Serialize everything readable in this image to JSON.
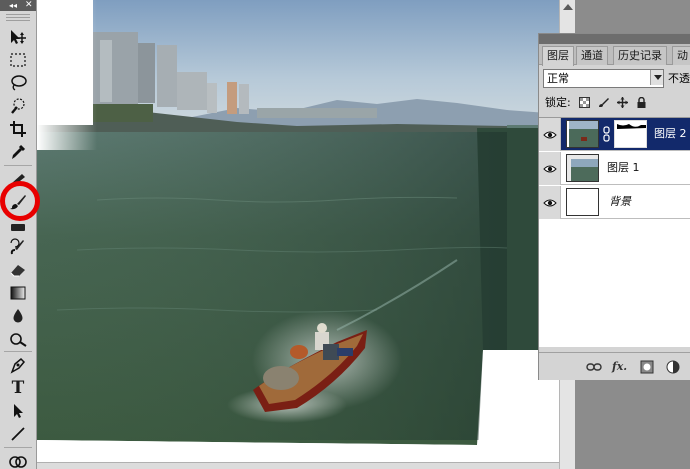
{
  "toolbox": {
    "collapse_glyph": "◂◂",
    "close_glyph": "✕",
    "tools": [
      {
        "name": "move-tool",
        "icon": "move-icon"
      },
      {
        "name": "marquee-tool",
        "icon": "marquee-icon"
      },
      {
        "name": "lasso-tool",
        "icon": "lasso-icon"
      },
      {
        "name": "quick-selection-tool",
        "icon": "quick-selection-icon"
      },
      {
        "name": "crop-tool",
        "icon": "crop-icon"
      },
      {
        "name": "eyedropper-tool",
        "icon": "eyedropper-icon"
      },
      {
        "name": "healing-brush-tool",
        "icon": "healing-brush-icon"
      },
      {
        "name": "brush-tool",
        "icon": "brush-icon"
      },
      {
        "name": "clone-stamp-tool",
        "icon": "clone-stamp-icon"
      },
      {
        "name": "history-brush-tool",
        "icon": "history-brush-icon"
      },
      {
        "name": "eraser-tool",
        "icon": "eraser-icon"
      },
      {
        "name": "gradient-tool",
        "icon": "gradient-icon"
      },
      {
        "name": "blur-tool",
        "icon": "blur-drop-icon"
      },
      {
        "name": "dodge-tool",
        "icon": "dodge-icon"
      },
      {
        "name": "pen-tool",
        "icon": "pen-icon"
      },
      {
        "name": "type-tool",
        "icon": "type-icon"
      },
      {
        "name": "path-selection-tool",
        "icon": "path-selection-icon"
      },
      {
        "name": "line-tool",
        "icon": "line-icon"
      },
      {
        "name": "3d-tool",
        "icon": "3d-rotate-icon"
      }
    ],
    "type_glyph": "T",
    "highlight_color": "#e80000"
  },
  "layers_panel": {
    "tabs": [
      {
        "label": "图层",
        "active": true
      },
      {
        "label": "通道",
        "active": false
      },
      {
        "label": "历史记录",
        "active": false
      },
      {
        "label": "动",
        "active": false
      }
    ],
    "blend_mode": "正常",
    "opacity_label": "不透",
    "lock_label": "锁定:",
    "layers": [
      {
        "name": "图层 2",
        "selected": true,
        "has_mask": true,
        "thumbnail": "photo"
      },
      {
        "name": "图层 1",
        "selected": false,
        "has_mask": false,
        "thumbnail": "photo"
      },
      {
        "name": "背景",
        "selected": false,
        "has_mask": false,
        "thumbnail": "white"
      }
    ],
    "footer_icons": [
      "link-icon",
      "fx-icon",
      "add-mask-icon",
      "adjustment-layer-icon"
    ],
    "fx_label": "fx.",
    "selected_color": "#12296b"
  }
}
